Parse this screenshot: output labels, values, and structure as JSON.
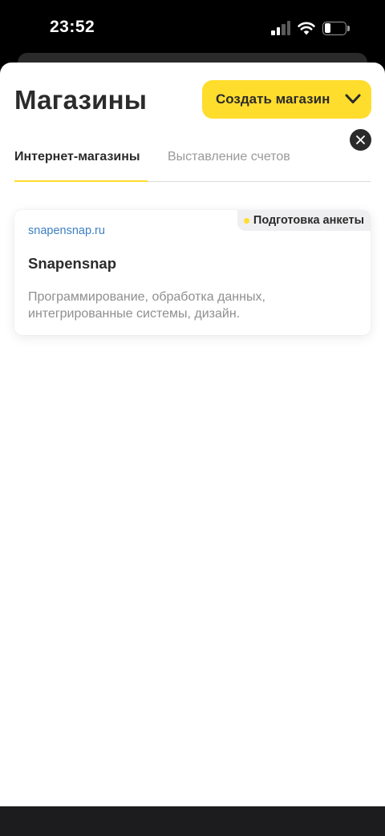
{
  "status_bar": {
    "time": "23:52",
    "icons": [
      "signal-icon",
      "wifi-icon",
      "battery-icon"
    ],
    "battery_level": 0.2
  },
  "header": {
    "title": "Магазины",
    "create_button_label": "Создать магазин"
  },
  "tabs": [
    {
      "label": "Интернет-магазины",
      "active": true
    },
    {
      "label": "Выставление счетов",
      "active": false
    }
  ],
  "shops": [
    {
      "url": "snapensnap.ru",
      "name": "Snapensnap",
      "description": "Программирование, обработка данных, интегрированные системы, дизайн.",
      "status": "Подготовка анкеты"
    }
  ],
  "colors": {
    "accent": "#ffdd2d",
    "link": "#3d7fc2",
    "text_primary": "#2b2b2b",
    "text_secondary": "#9a9a9a",
    "status_dot": "#ffdd2d"
  }
}
